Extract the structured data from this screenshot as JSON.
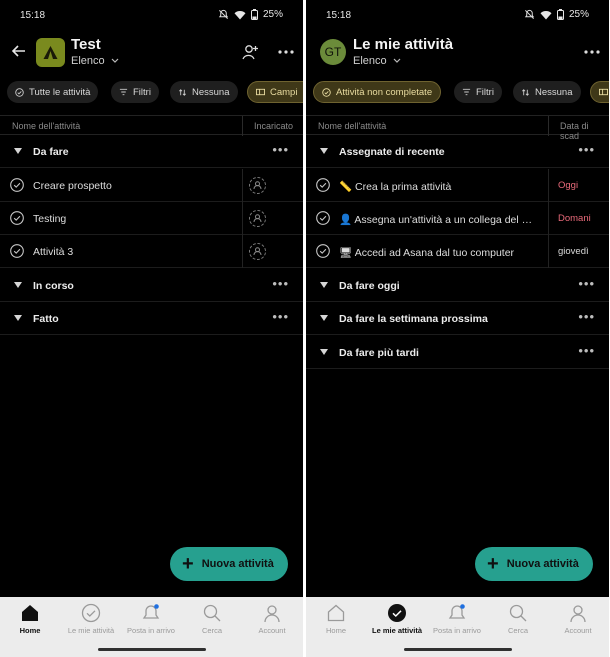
{
  "status": {
    "time": "15:18",
    "battery": "25%"
  },
  "left": {
    "title": "Test",
    "view": "Elenco",
    "chips": [
      "Tutte le attività",
      "Filtri",
      "Nessuna",
      "Campi"
    ],
    "columns": [
      "Nome dell'attività",
      "Incaricato"
    ],
    "sections": [
      {
        "label": "Da fare",
        "tasks": [
          "Creare prospetto",
          "Testing",
          "Attività 3"
        ]
      },
      {
        "label": "In corso",
        "tasks": []
      },
      {
        "label": "Fatto",
        "tasks": []
      }
    ],
    "fab": "Nuova attività"
  },
  "right": {
    "avatar": "GT",
    "title": "Le mie attività",
    "view": "Elenco",
    "chips": [
      "Attività non completate",
      "Filtri",
      "Nessuna"
    ],
    "columns": [
      "Nome dell'attività",
      "Data di scad"
    ],
    "sections": [
      {
        "label": "Assegnate di recente",
        "tasks": [
          {
            "emoji": "📏",
            "label": "Crea la prima attività",
            "date": "Oggi",
            "date_color": "#e96a7a"
          },
          {
            "emoji": "👤",
            "label": "Assegna un'attività a un collega del …",
            "date": "Domani",
            "date_color": "#e96a7a"
          },
          {
            "emoji": "🖥",
            "label": "Accedi ad Asana dal tuo computer",
            "date": "giovedì",
            "date_color": "#d8d8d8"
          }
        ]
      },
      {
        "label": "Da fare oggi"
      },
      {
        "label": "Da fare la settimana prossima"
      },
      {
        "label": "Da fare più tardi"
      }
    ],
    "fab": "Nuova attività"
  },
  "nav": [
    "Home",
    "Le mie attività",
    "Posta in arrivo",
    "Cerca",
    "Account"
  ],
  "colors": {
    "accent_fab": "#26a08f",
    "project_icon": "#7a8a1e",
    "chip_active_bg": "#3f3818",
    "notification_dot": "#1e6fe0"
  }
}
